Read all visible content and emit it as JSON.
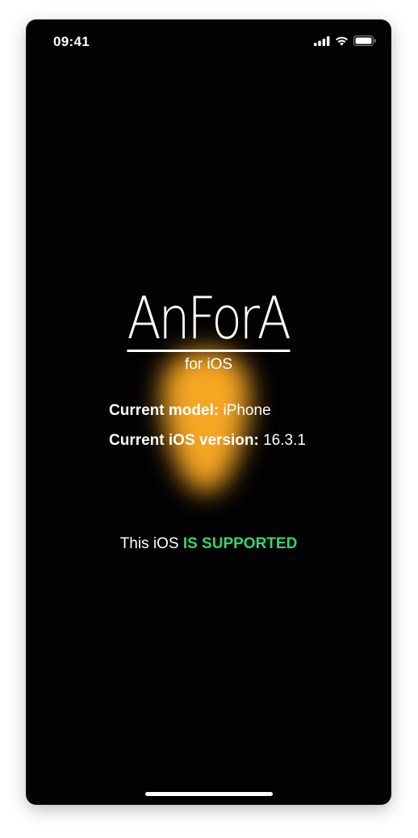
{
  "status_bar": {
    "time": "09:41",
    "icons": [
      "cellular-signal-icon",
      "wifi-icon",
      "battery-icon"
    ]
  },
  "app": {
    "title": "AnForA",
    "subtitle": "for iOS"
  },
  "device_info": {
    "model_label": "Current model:",
    "model_value": "iPhone",
    "version_label": "Current iOS version:",
    "version_value": "16.3.1"
  },
  "support": {
    "prefix": "This iOS",
    "status": "IS SUPPORTED",
    "status_color": "#33d66d"
  },
  "colors": {
    "background": "#020103",
    "glow": "#f5a623"
  }
}
